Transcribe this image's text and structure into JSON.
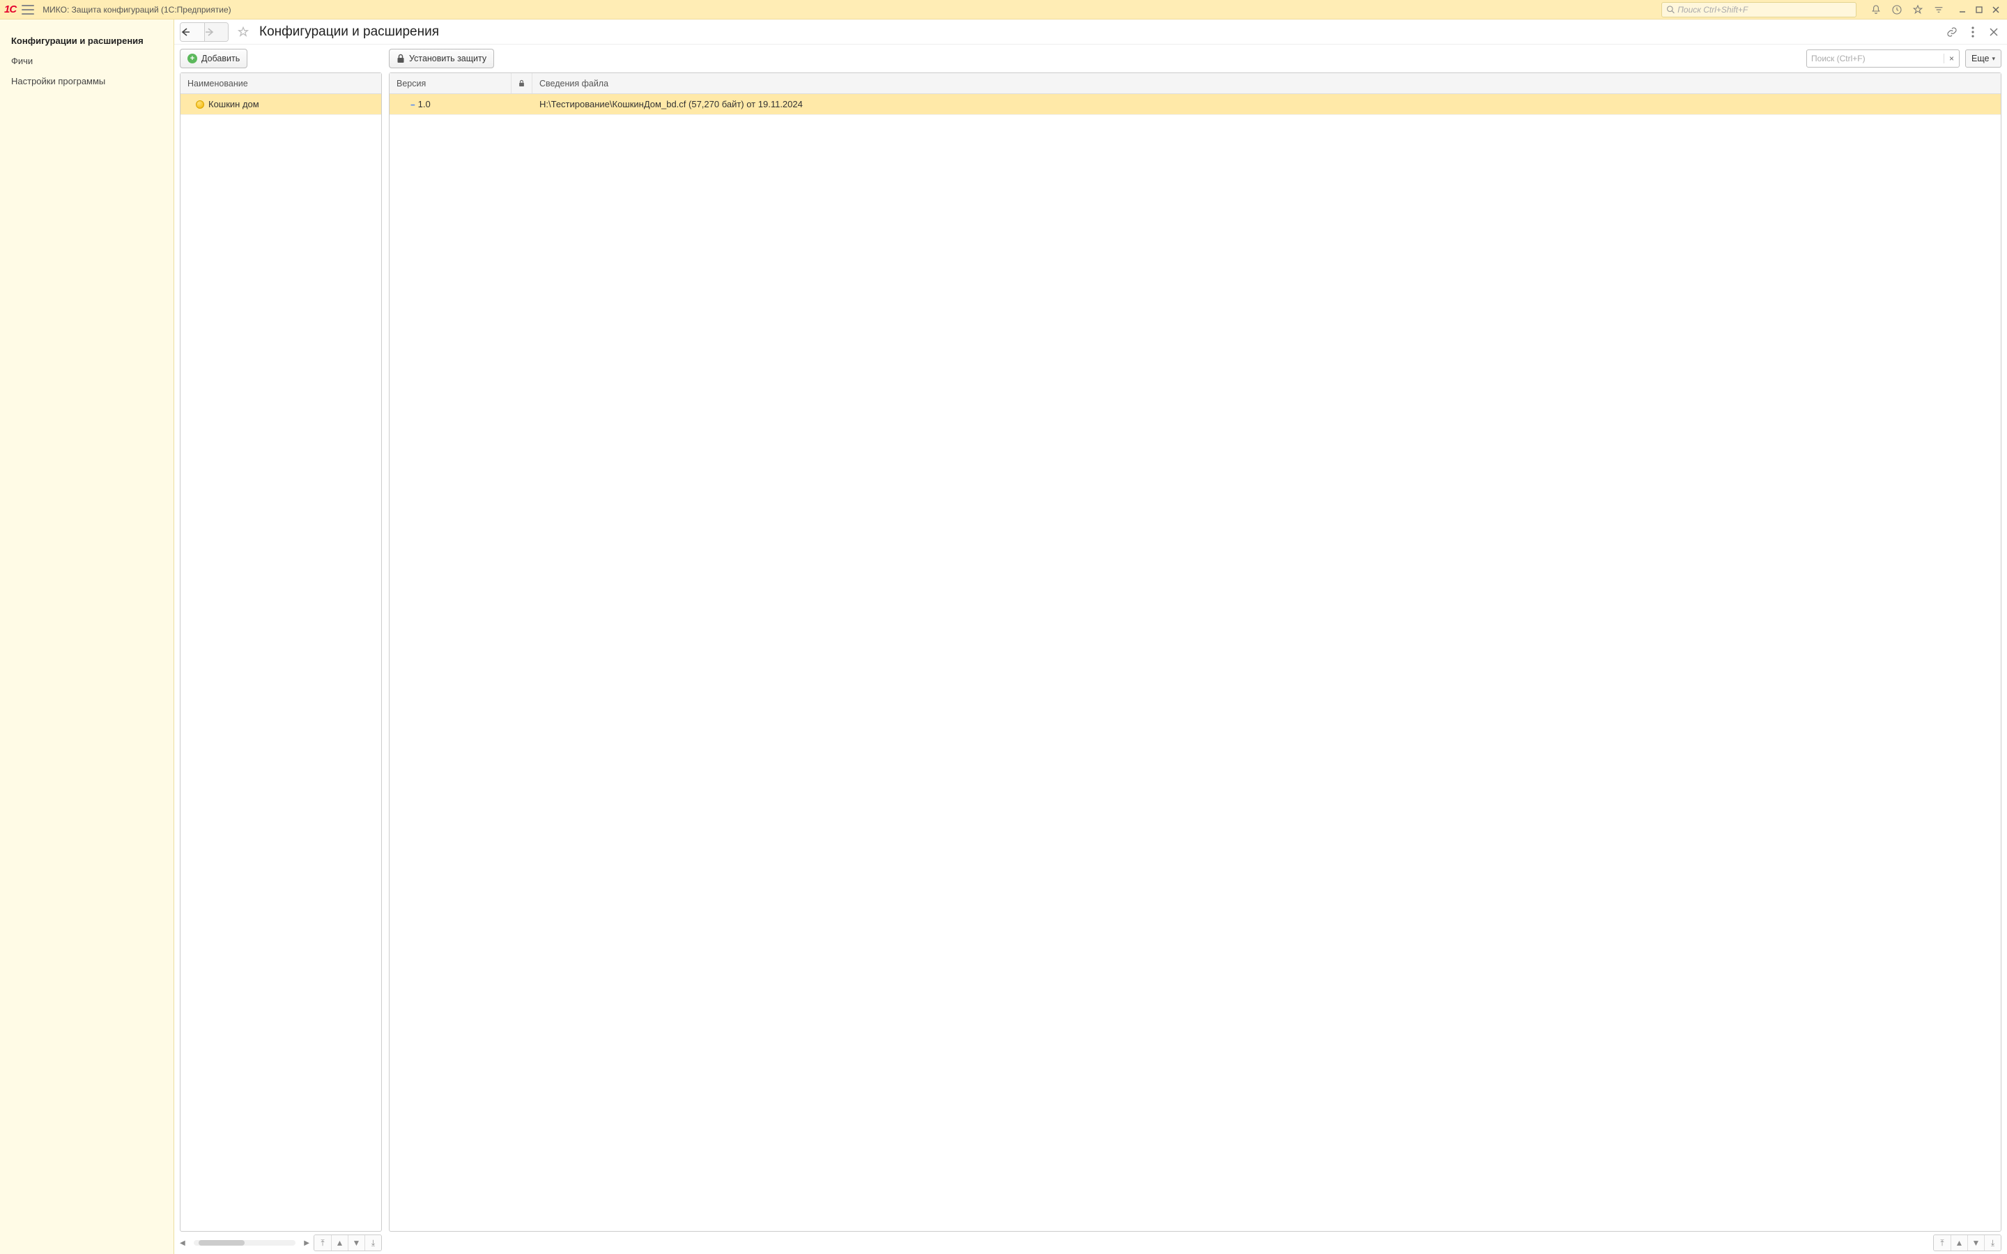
{
  "app": {
    "title": "МИКО: Защита конфигураций  (1С:Предприятие)",
    "search_placeholder": "Поиск Ctrl+Shift+F"
  },
  "sidebar": {
    "items": [
      {
        "label": "Конфигурации и расширения",
        "active": true
      },
      {
        "label": "Фичи",
        "active": false
      },
      {
        "label": "Настройки программы",
        "active": false
      }
    ]
  },
  "page": {
    "title": "Конфигурации и расширения",
    "add_label": "Добавить",
    "protect_label": "Установить защиту",
    "search_placeholder": "Поиск (Ctrl+F)",
    "more_label": "Еще"
  },
  "left_table": {
    "header": {
      "name": "Наименование"
    },
    "rows": [
      {
        "name": "Кошкин дом"
      }
    ]
  },
  "right_table": {
    "header": {
      "version": "Версия",
      "lock_icon": "lock-icon",
      "file_info": "Сведения файла"
    },
    "rows": [
      {
        "version": "1.0",
        "locked": false,
        "file_info": "H:\\Тестирование\\КошкинДом_bd.cf (57,270 байт) от 19.11.2024"
      }
    ]
  }
}
